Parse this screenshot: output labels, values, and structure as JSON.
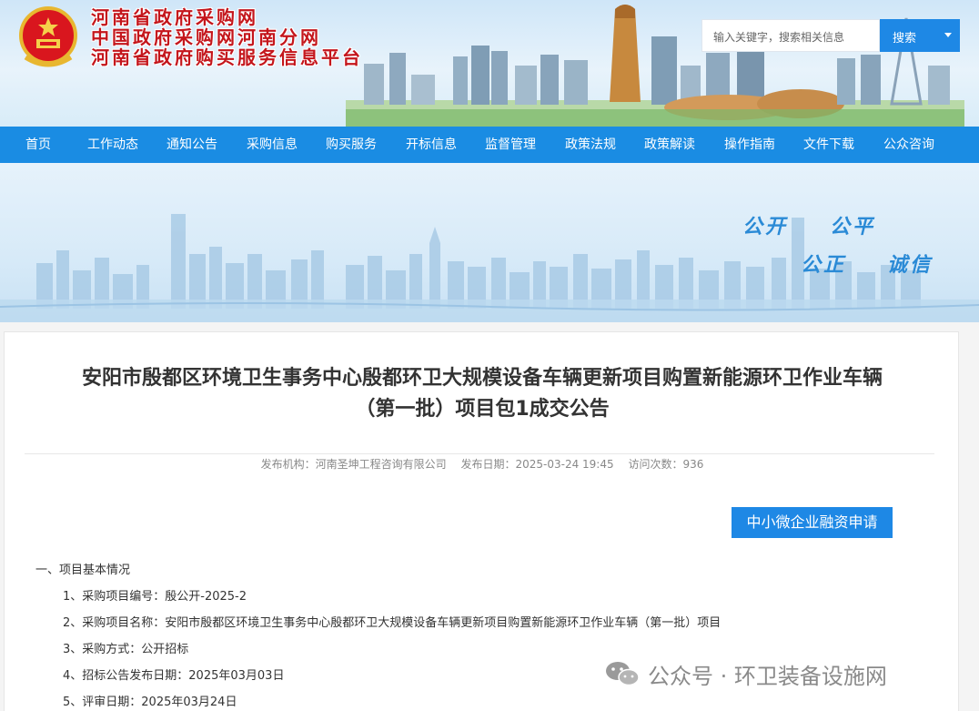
{
  "header": {
    "site_titles": [
      "河南省政府采购网",
      "中国政府采购网河南分网",
      "河南省政府购买服务信息平台"
    ],
    "search_placeholder": "输入关键字，搜索相关信息",
    "search_button": "搜索"
  },
  "nav": {
    "items": [
      "首页",
      "工作动态",
      "通知公告",
      "采购信息",
      "购买服务",
      "开标信息",
      "监督管理",
      "政策法规",
      "政策解读",
      "操作指南",
      "文件下载",
      "公众咨询"
    ]
  },
  "banner": {
    "slogans": [
      "公开",
      "公平",
      "公正",
      "诚信"
    ]
  },
  "article": {
    "title_line1": "安阳市殷都区环境卫生事务中心殷都环卫大规模设备车辆更新项目购置新能源环卫作业车辆",
    "title_line2": "（第一批）项目包1成交公告",
    "meta": {
      "publisher": "发布机构：河南圣坤工程咨询有限公司",
      "date": "发布日期：2025-03-24 19:45",
      "visits": "访问次数：936"
    },
    "finance_button": "中小微企业融资申请",
    "section_heading": "一、项目基本情况",
    "items": [
      "1、采购项目编号：殷公开-2025-2",
      "2、采购项目名称：安阳市殷都区环境卫生事务中心殷都环卫大规模设备车辆更新项目购置新能源环卫作业车辆（第一批）项目",
      "3、采购方式：公开招标",
      "4、招标公告发布日期：2025年03月03日",
      "5、评审日期：2025年03月24日"
    ]
  },
  "watermark": {
    "text": "公众号 · 环卫装备设施网",
    "icon": "wechat-icon"
  },
  "colors": {
    "nav_blue": "#1a8ce3",
    "button_blue": "#1e88e5",
    "title_red": "#c4161c"
  }
}
